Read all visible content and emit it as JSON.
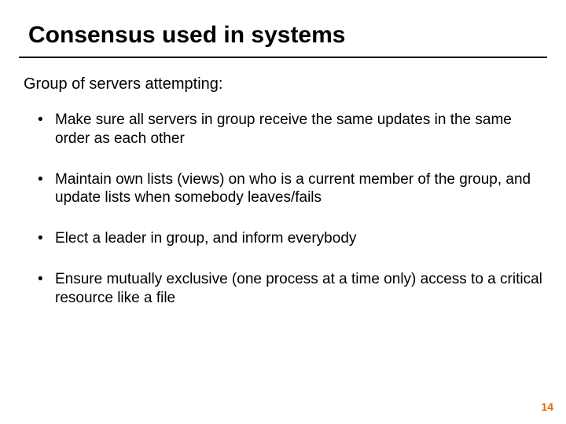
{
  "title": "Consensus used in systems",
  "intro": "Group of servers attempting:",
  "bullets": [
    "Make sure all servers in group receive the same updates in the same order as each other",
    "Maintain own lists (views) on who is a current member of the group, and update lists when somebody leaves/fails",
    "Elect a leader in group, and inform everybody",
    "Ensure mutually exclusive (one process at a time only) access to a critical resource like a file"
  ],
  "page_number": "14"
}
